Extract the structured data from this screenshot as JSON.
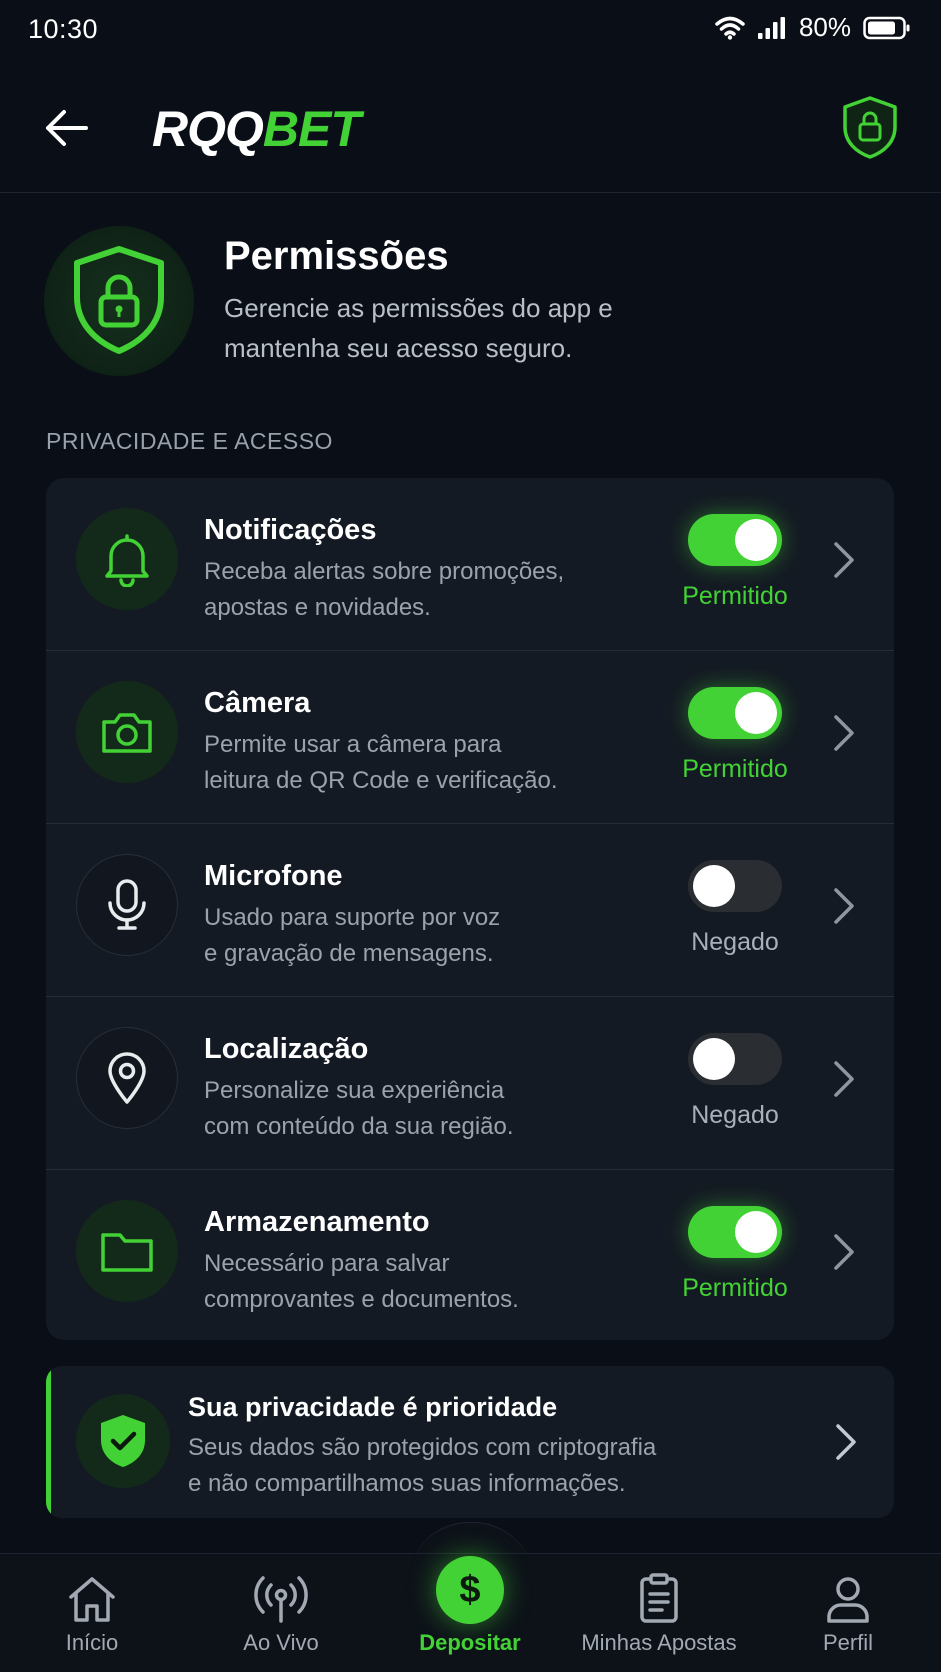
{
  "status_bar": {
    "time": "10:30",
    "battery": "80%"
  },
  "header": {
    "logo_white": "RQQ",
    "logo_green": "BET"
  },
  "intro": {
    "title": "Permissões",
    "description": "Gerencie as permissões do app e mantenha seu acesso seguro."
  },
  "section_label": "PRIVACIDADE E ACESSO",
  "permissions": [
    {
      "title": "Notificações",
      "desc_line1": "Receba alertas sobre promoções,",
      "desc_line2": "apostas e novidades.",
      "enabled": true,
      "status": "Permitido",
      "icon": "bell-icon"
    },
    {
      "title": "Câmera",
      "desc_line1": "Permite usar a câmera para",
      "desc_line2": "leitura de QR Code e verificação.",
      "enabled": true,
      "status": "Permitido",
      "icon": "camera-icon"
    },
    {
      "title": "Microfone",
      "desc_line1": "Usado para suporte por voz",
      "desc_line2": "e gravação de mensagens.",
      "enabled": false,
      "status": "Negado",
      "icon": "microphone-icon"
    },
    {
      "title": "Localização",
      "desc_line1": "Personalize sua experiência",
      "desc_line2": "com conteúdo da sua região.",
      "enabled": false,
      "status": "Negado",
      "icon": "location-pin-icon"
    },
    {
      "title": "Armazenamento",
      "desc_line1": "Necessário para salvar",
      "desc_line2": "comprovantes e documentos.",
      "enabled": true,
      "status": "Permitido",
      "icon": "folder-icon"
    }
  ],
  "privacy": {
    "title": "Sua privacidade é prioridade",
    "desc_line1": "Seus dados são protegidos com criptografia",
    "desc_line2": "e não compartilhamos suas informações."
  },
  "nav": {
    "items": [
      {
        "label": "Início",
        "icon": "home-icon"
      },
      {
        "label": "Ao Vivo",
        "icon": "broadcast-icon"
      },
      {
        "label": "Depositar",
        "icon": "dollar-icon"
      },
      {
        "label": "Minhas Apostas",
        "icon": "clipboard-icon"
      },
      {
        "label": "Perfil",
        "icon": "user-icon"
      }
    ],
    "deposit_symbol": "$"
  },
  "colors": {
    "accent": "#43d235",
    "background": "#0a0f17",
    "card": "#141a23"
  }
}
